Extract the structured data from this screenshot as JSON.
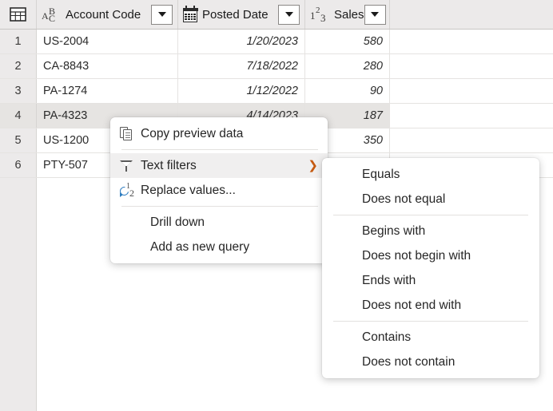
{
  "grid": {
    "gutter_icon": "table-icon",
    "columns": [
      {
        "name": "Account Code",
        "type_icon": "abc-text-type-icon",
        "align": "left"
      },
      {
        "name": "Posted Date",
        "type_icon": "calendar-date-type-icon",
        "align": "right"
      },
      {
        "name": "Sales",
        "type_icon": "123-number-type-icon",
        "align": "right"
      }
    ],
    "dropdown_label": "▼",
    "rows": [
      {
        "num": "1",
        "account_code": "US-2004",
        "posted_date": "1/20/2023",
        "sales": "580",
        "selected": false
      },
      {
        "num": "2",
        "account_code": "CA-8843",
        "posted_date": "7/18/2022",
        "sales": "280",
        "selected": false
      },
      {
        "num": "3",
        "account_code": "PA-1274",
        "posted_date": "1/12/2022",
        "sales": "90",
        "selected": false
      },
      {
        "num": "4",
        "account_code": "PA-4323",
        "posted_date": "4/14/2023",
        "sales": "187",
        "selected": true
      },
      {
        "num": "5",
        "account_code": "US-1200",
        "posted_date": "",
        "sales": "350",
        "selected": false
      },
      {
        "num": "6",
        "account_code": "PTY-507",
        "posted_date": "",
        "sales": "",
        "selected": false
      }
    ]
  },
  "context_menu": {
    "items": [
      {
        "label": "Copy preview data",
        "icon": "copy-icon",
        "has_submenu": false,
        "highlighted": false
      },
      {
        "label": "Text filters",
        "icon": "funnel-icon",
        "has_submenu": true,
        "highlighted": true
      },
      {
        "label": "Replace values...",
        "icon": "replace-values-icon",
        "has_submenu": false,
        "highlighted": false
      },
      {
        "label": "Drill down",
        "icon": "",
        "has_submenu": false,
        "highlighted": false
      },
      {
        "label": "Add as new query",
        "icon": "",
        "has_submenu": false,
        "highlighted": false
      }
    ],
    "submenu_arrow": "❯"
  },
  "submenu": {
    "items": [
      {
        "label": "Equals"
      },
      {
        "label": "Does not equal"
      },
      {
        "label": "Begins with"
      },
      {
        "label": "Does not begin with"
      },
      {
        "label": "Ends with"
      },
      {
        "label": "Does not end with"
      },
      {
        "label": "Contains"
      },
      {
        "label": "Does not contain"
      }
    ]
  },
  "colors": {
    "header_bg": "#eceaea",
    "selected_row": "#e6e4e2",
    "menu_highlight": "#f0efef",
    "accent_orange": "#c55a11",
    "icon_blue": "#2f7dc0"
  }
}
